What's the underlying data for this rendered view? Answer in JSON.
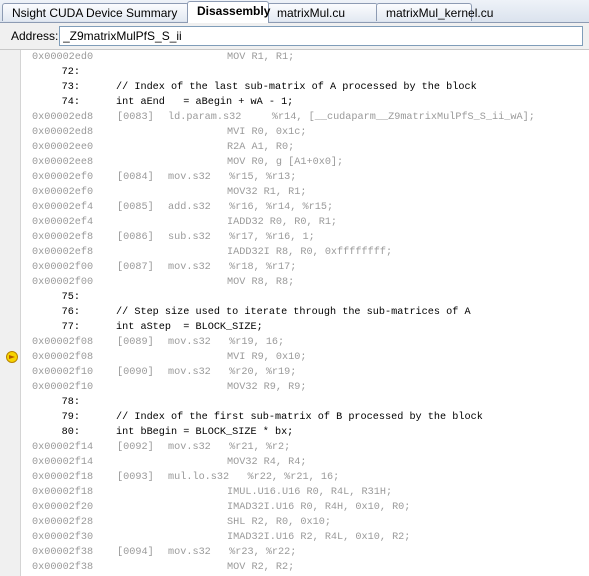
{
  "tabs": [
    "Nsight CUDA Device Summary",
    "Disassembly",
    "matrixMul.cu",
    "matrixMul_kernel.cu"
  ],
  "address": {
    "label": "Address:",
    "value": "_Z9matrixMulPfS_S_ii"
  },
  "lines": [
    {
      "k": "asm",
      "addr": "0x00002ed0",
      "idx": "",
      "ptx": "",
      "sass": "MOV R1, R1;"
    },
    {
      "k": "src",
      "ln": "72:",
      "text": ""
    },
    {
      "k": "src",
      "ln": "73:",
      "text": "// Index of the last sub-matrix of A processed by the block"
    },
    {
      "k": "src",
      "ln": "74:",
      "text": "int aEnd   = aBegin + wA - 1;"
    },
    {
      "k": "asm",
      "addr": "0x00002ed8",
      "idx": "[0083]",
      "ptx": "ld.param.s32     %r14, [__cudaparm__Z9matrixMulPfS_S_ii_wA];",
      "sass": ""
    },
    {
      "k": "asm",
      "addr": "0x00002ed8",
      "idx": "",
      "ptx": "",
      "sass": "MVI R0, 0x1c;"
    },
    {
      "k": "asm",
      "addr": "0x00002ee0",
      "idx": "",
      "ptx": "",
      "sass": "R2A A1, R0;"
    },
    {
      "k": "asm",
      "addr": "0x00002ee8",
      "idx": "",
      "ptx": "",
      "sass": "MOV R0, g [A1+0x0];"
    },
    {
      "k": "asm",
      "addr": "0x00002ef0",
      "idx": "[0084]",
      "ptx": "mov.s32   %r15, %r13;",
      "sass": ""
    },
    {
      "k": "asm",
      "addr": "0x00002ef0",
      "idx": "",
      "ptx": "",
      "sass": "MOV32 R1, R1;"
    },
    {
      "k": "asm",
      "addr": "0x00002ef4",
      "idx": "[0085]",
      "ptx": "add.s32   %r16, %r14, %r15;",
      "sass": ""
    },
    {
      "k": "asm",
      "addr": "0x00002ef4",
      "idx": "",
      "ptx": "",
      "sass": "IADD32 R0, R0, R1;"
    },
    {
      "k": "asm",
      "addr": "0x00002ef8",
      "idx": "[0086]",
      "ptx": "sub.s32   %r17, %r16, 1;",
      "sass": ""
    },
    {
      "k": "asm",
      "addr": "0x00002ef8",
      "idx": "",
      "ptx": "",
      "sass": "IADD32I R8, R0, 0xffffffff;"
    },
    {
      "k": "asm",
      "addr": "0x00002f00",
      "idx": "[0087]",
      "ptx": "mov.s32   %r18, %r17;",
      "sass": ""
    },
    {
      "k": "asm",
      "addr": "0x00002f00",
      "idx": "",
      "ptx": "",
      "sass": "MOV R8, R8;"
    },
    {
      "k": "src",
      "ln": "75:",
      "text": ""
    },
    {
      "k": "src",
      "ln": "76:",
      "text": "// Step size used to iterate through the sub-matrices of A"
    },
    {
      "k": "src",
      "ln": "77:",
      "text": "int aStep  = BLOCK_SIZE;"
    },
    {
      "k": "asm",
      "addr": "0x00002f08",
      "idx": "[0089]",
      "ptx": "mov.s32   %r19, 16;",
      "sass": ""
    },
    {
      "k": "asm",
      "addr": "0x00002f08",
      "idx": "",
      "ptx": "",
      "sass": "MVI R9, 0x10;"
    },
    {
      "k": "asm",
      "addr": "0x00002f10",
      "idx": "[0090]",
      "ptx": "mov.s32   %r20, %r19;",
      "sass": ""
    },
    {
      "k": "asm",
      "addr": "0x00002f10",
      "idx": "",
      "ptx": "",
      "sass": "MOV32 R9, R9;"
    },
    {
      "k": "src",
      "ln": "78:",
      "text": ""
    },
    {
      "k": "src",
      "ln": "79:",
      "text": "// Index of the first sub-matrix of B processed by the block"
    },
    {
      "k": "src",
      "ln": "80:",
      "text": "int bBegin = BLOCK_SIZE * bx;"
    },
    {
      "k": "asm",
      "addr": "0x00002f14",
      "idx": "[0092]",
      "ptx": "mov.s32   %r21, %r2;",
      "sass": ""
    },
    {
      "k": "asm",
      "addr": "0x00002f14",
      "idx": "",
      "ptx": "",
      "sass": "MOV32 R4, R4;"
    },
    {
      "k": "asm",
      "addr": "0x00002f18",
      "idx": "[0093]",
      "ptx": "mul.lo.s32   %r22, %r21, 16;",
      "sass": ""
    },
    {
      "k": "asm",
      "addr": "0x00002f18",
      "idx": "",
      "ptx": "",
      "sass": "IMUL.U16.U16 R0, R4L, R31H;"
    },
    {
      "k": "asm",
      "addr": "0x00002f20",
      "idx": "",
      "ptx": "",
      "sass": "IMAD32I.U16 R0, R4H, 0x10, R0;"
    },
    {
      "k": "asm",
      "addr": "0x00002f28",
      "idx": "",
      "ptx": "",
      "sass": "SHL R2, R0, 0x10;"
    },
    {
      "k": "asm",
      "addr": "0x00002f30",
      "idx": "",
      "ptx": "",
      "sass": "IMAD32I.U16 R2, R4L, 0x10, R2;"
    },
    {
      "k": "asm",
      "addr": "0x00002f38",
      "idx": "[0094]",
      "ptx": "mov.s32   %r23, %r22;",
      "sass": ""
    },
    {
      "k": "asm",
      "addr": "0x00002f38",
      "idx": "",
      "ptx": "",
      "sass": "MOV R2, R2;"
    }
  ],
  "current_line_marker": "arrow-icon"
}
